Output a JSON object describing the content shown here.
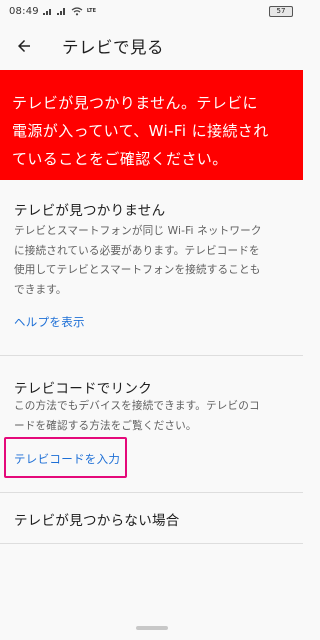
{
  "status_bar": {
    "time": "08:49",
    "network": "LTE",
    "battery": "57"
  },
  "app_bar": {
    "back_icon": "arrow-left-icon",
    "title": "テレビで見る"
  },
  "alert": {
    "color": "#ff0000",
    "lines": [
      "テレビが見つかりません。テレビに",
      "電源が入っていて、Wi-Fi に接続され",
      "ていることをご確認ください。"
    ]
  },
  "not_found_section": {
    "title": "テレビが見つかりません",
    "body_lines": [
      "テレビとスマートフォンが同じ Wi-Fi ネットワーク",
      "に接続されている必要があります。テレビコードを",
      "使用してテレビとスマートフォンを接続することも",
      "できます。"
    ],
    "help_link": "ヘルプを表示"
  },
  "tv_code_section": {
    "title": "テレビコードでリンク",
    "body_lines": [
      "この方法でもデバイスを接続できます。テレビのコ",
      "ードを確認する方法をご覧ください。"
    ],
    "enter_code_link": "テレビコードを入力"
  },
  "troubleshoot": {
    "label": "テレビが見つからない場合"
  },
  "colors": {
    "link": "#1d6fd6",
    "highlight": "#e4097a"
  }
}
